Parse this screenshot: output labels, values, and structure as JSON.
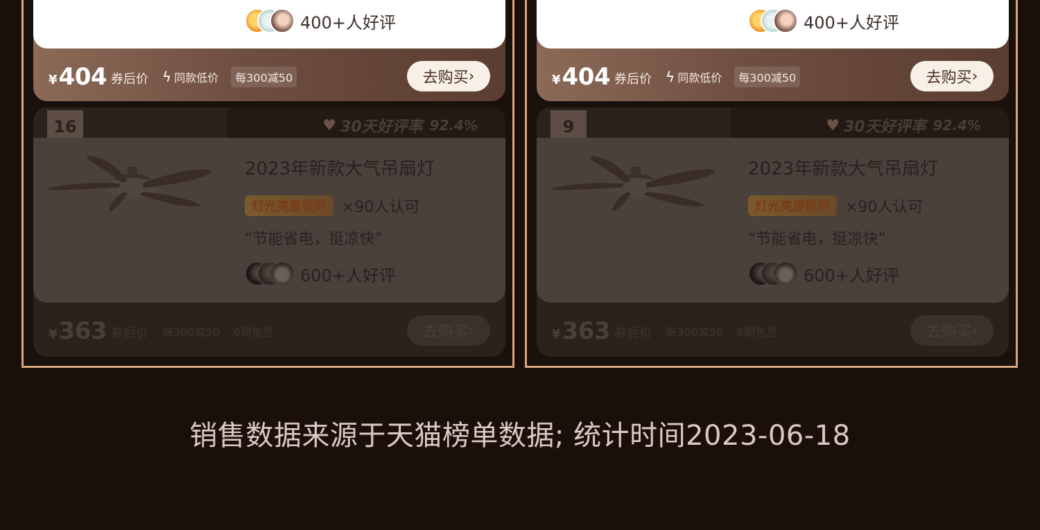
{
  "products": [
    {
      "top_card": {
        "reviews_text": "400+人好评",
        "currency": "¥",
        "price": "404",
        "price_label": "券后价",
        "promo_icon": "bolt-icon",
        "promo_label": "同款低价",
        "discount_chip": "每300减50",
        "buy_label": "去购买"
      },
      "ranked_card": {
        "rank": "16",
        "rating_label": "30天好评率",
        "rating_value": "92.4%",
        "title": "2023年新款大气吊扇灯",
        "feature_label": "灯光亮度很好",
        "feature_count": "×90人认可",
        "quote": "“节能省电，挺凉快”",
        "reviews_text": "600+人好评",
        "currency": "¥",
        "price": "363",
        "price_label": "券后价",
        "chip_a": "每300减50",
        "chip_b": "6期免息",
        "buy_label": "去购买"
      }
    },
    {
      "top_card": {
        "reviews_text": "400+人好评",
        "currency": "¥",
        "price": "404",
        "price_label": "券后价",
        "promo_icon": "bolt-icon",
        "promo_label": "同款低价",
        "discount_chip": "每300减50",
        "buy_label": "去购买"
      },
      "ranked_card": {
        "rank": "9",
        "rating_label": "30天好评率",
        "rating_value": "92.4%",
        "title": "2023年新款大气吊扇灯",
        "feature_label": "灯光亮度很好",
        "feature_count": "×90人认可",
        "quote": "“节能省电，挺凉快”",
        "reviews_text": "600+人好评",
        "currency": "¥",
        "price": "363",
        "price_label": "券后价",
        "chip_a": "每300减50",
        "chip_b": "6期免息",
        "buy_label": "去购买"
      }
    }
  ],
  "footer": {
    "note": "销售数据来源于天猫榜单数据; 统计时间2023-06-18"
  },
  "colors": {
    "background": "#1b0f0b",
    "frame_border": "#d7a77c",
    "buy_button": "#f8efe7"
  }
}
